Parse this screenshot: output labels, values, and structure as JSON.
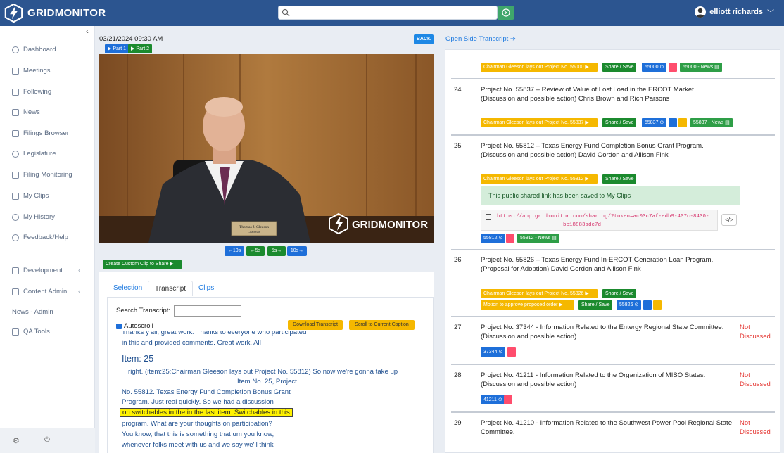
{
  "app": {
    "name": "GRIDMONITOR"
  },
  "search": {
    "placeholder": ""
  },
  "user": {
    "name": "elliott richards"
  },
  "sidebar": {
    "items": [
      {
        "label": "Dashboard"
      },
      {
        "label": "Meetings"
      },
      {
        "label": "Following"
      },
      {
        "label": "News"
      },
      {
        "label": "Filings Browser"
      },
      {
        "label": "Legislature"
      },
      {
        "label": "Filing Monitoring"
      },
      {
        "label": "My Clips"
      },
      {
        "label": "My History"
      },
      {
        "label": "Feedback/Help"
      },
      {
        "label": "Development"
      },
      {
        "label": "Content Admin"
      },
      {
        "label": "News - Admin"
      },
      {
        "label": "QA Tools"
      }
    ]
  },
  "video": {
    "date": "03/21/2024 09:30 AM",
    "back_label": "BACK",
    "part1": "▶ Part 1",
    "part2": "▶ Part 2",
    "nameplate_name": "Thomas J. Gleeson",
    "nameplate_title": "Chairman",
    "watermark": "GRIDMONITOR",
    "skip": [
      "←10s",
      "←5s",
      "5s→",
      "10s→"
    ],
    "custom_clip": "Create Custom Clip to Share ▶"
  },
  "tabs": [
    "Selection",
    "Transcript",
    "Clips"
  ],
  "transcript": {
    "search_label": "Search Transcript:",
    "autoscroll": "Autoscroll",
    "download": "Download Transcript",
    "scroll_caption": "Scroll to Current Caption",
    "line_top1": "Thanks y'all, great work. Thanks to everyone who participated",
    "line_top2": "in this and provided comments. Great work. All",
    "item_heading": "Item: 25",
    "lines": [
      "right. (item:25:Chairman Gleeson lays out Project No. 55812) So now we're gonna take up",
      "Item No. 25, Project",
      "No. 55812. Texas Energy Fund Completion Bonus Grant",
      "Program. Just real quickly. So we had a discussion"
    ],
    "highlight": "on switchables in the in the last item. Switchables in this",
    "lines_after": [
      "program. What are your thoughts on participation?",
      "You know, that this is something that um you know,",
      "whenever folks meet with us and we say we'll think"
    ]
  },
  "right": {
    "open_side": "Open Side Transcript ➔",
    "top_row": {
      "laysout": "Chairman Gleeson lays out Project No. 55000 ▶",
      "share": "Share / Save",
      "proj": "55000 ⊙",
      "news": "55000 - News ▤"
    },
    "items": [
      {
        "num": "24",
        "line1": "Project No. 55837 – Review of Value of Lost Load in the ERCOT Market.",
        "line2": "(Discussion and possible action) Chris Brown and Rich Parsons",
        "laysout": "Chairman Gleeson lays out Project No. 55837 ▶",
        "share": "Share / Save",
        "proj": "55837 ⊙",
        "news": "55837 - News ▤"
      },
      {
        "num": "25",
        "line1": "Project No. 55812 – Texas Energy Fund Completion Bonus Grant Program.",
        "line2": "(Discussion and possible action) David Gordon and Allison Fink",
        "laysout": "Chairman Gleeson lays out Project No. 55812 ▶",
        "share": "Share / Save",
        "proj": "55812 ⊙",
        "news": "55812 - News ▤",
        "success": "This public shared link has been saved to My Clips",
        "link1": "https://app.gridmonitor.com/sharing/?token=ac03c7af-edb9-407c-8430-",
        "link2": "bc18883adc7d",
        "code": "</>"
      },
      {
        "num": "26",
        "line1": "Project No. 55826 – Texas Energy Fund In-ERCOT Generation Loan Program.",
        "line2": "(Proposal for Adoption) David Gordon and Allison Fink",
        "laysout": "Chairman Gleeson lays out Project No. 55826 ▶",
        "share": "Share / Save",
        "motion": "Motion to approve proposed order ▶",
        "share2": "Share / Save",
        "proj": "55826 ⊙"
      },
      {
        "num": "27",
        "line1": "Project No. 37344 - Information Related to the Entergy Regional State Committee.",
        "line2": "(Discussion and possible action)",
        "status1": "Not",
        "status2": "Discussed",
        "proj": "37344 ⊙"
      },
      {
        "num": "28",
        "line1": "Project No. 41211 - Information Related to the Organization of MISO States.",
        "line2": "(Discussion and possible action)",
        "status1": "Not",
        "status2": "Discussed",
        "proj": "41211 ⊙"
      },
      {
        "num": "29",
        "line1": "Project No. 41210 - Information Related to the Southwest Power Pool Regional State",
        "line2": "Committee.",
        "status1": "Not",
        "status2": "Discussed"
      }
    ]
  },
  "colors": {
    "topbar": "#2c5590",
    "accent_blue": "#1e6fd9",
    "green": "#1b8a2e",
    "yellow": "#f5b800",
    "pink": "#ff4d6d",
    "not_discussed": "#e53935"
  }
}
